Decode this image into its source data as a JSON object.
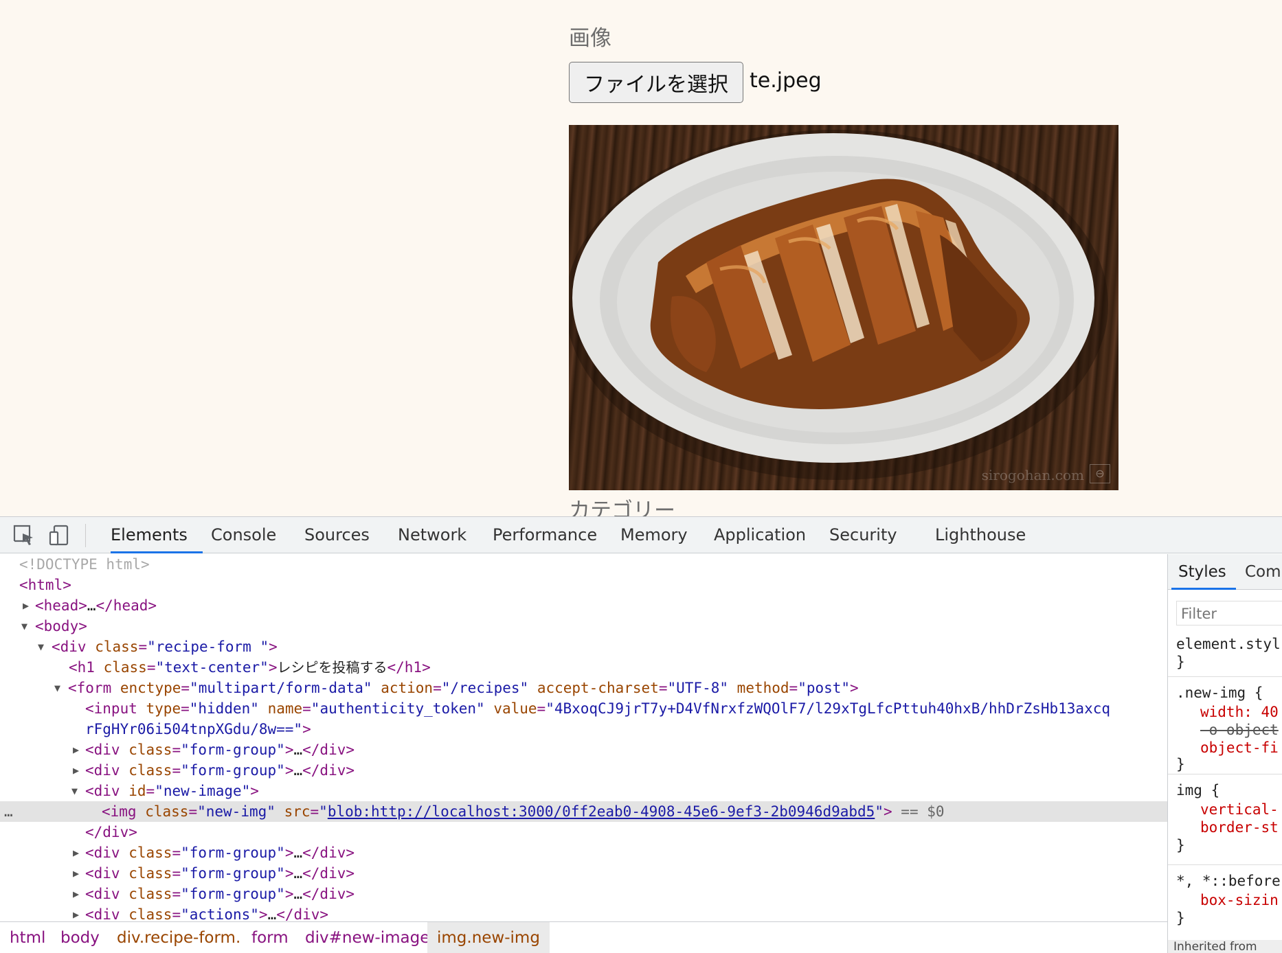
{
  "page": {
    "image_label": "画像",
    "file_button_label": "ファイルを選択",
    "file_name": "te.jpeg",
    "watermark": "sirogohan.com",
    "category_label": "カテゴリー"
  },
  "devtools": {
    "tabs": [
      "Elements",
      "Console",
      "Sources",
      "Network",
      "Performance",
      "Memory",
      "Application",
      "Security",
      "Lighthouse"
    ],
    "active_tab": "Elements",
    "dom": {
      "doctype": "<!DOCTYPE html>",
      "html_open": "<html>",
      "head": {
        "open": "<head>",
        "ellipsis": "…",
        "close": "</head>"
      },
      "body_open": "<body>",
      "div_recipe": {
        "tag": "<div",
        "attr": "class",
        "value": "\"recipe-form \"",
        "end": ">"
      },
      "h1": {
        "tag": "<h1",
        "attr": "class",
        "value": "\"text-center\"",
        "text": "レシピを投稿する",
        "close": "</h1>"
      },
      "form": {
        "tag": "<form",
        "attrs": [
          {
            "name": "enctype",
            "value": "\"multipart/form-data\""
          },
          {
            "name": "action",
            "value": "\"/recipes\""
          },
          {
            "name": "accept-charset",
            "value": "\"UTF-8\""
          },
          {
            "name": "method",
            "value": "\"post\""
          }
        ]
      },
      "input": {
        "tag": "<input",
        "type_attr": "type",
        "type_value": "\"hidden\"",
        "name_attr": "name",
        "name_value": "\"authenticity_token\"",
        "value_attr": "value",
        "value_line1": "\"4BxoqCJ9jrT7y+D4VfNrxfzWQOlF7/l29xTgLfcPttuh40hxB/hhDrZsHb13axcq",
        "value_line2": "rFgHYr06i504tnpXGdu/8w==\""
      },
      "form_group": {
        "tag": "<div",
        "attr": "class",
        "value": "\"form-group\"",
        "ellipsis": "…",
        "close": "</div>"
      },
      "new_image_div": {
        "tag": "<div",
        "attr": "id",
        "value": "\"new-image\""
      },
      "img": {
        "tag": "<img",
        "class_attr": "class",
        "class_value": "\"new-img\"",
        "src_attr": "src",
        "src": "blob:http://localhost:3000/0ff2eab0-4908-45e6-9ef3-2b0946d9abd5",
        "selected_marker": "== $0",
        "dots": "…"
      },
      "div_close": "</div>",
      "actions": {
        "tag": "<div",
        "attr": "class",
        "value": "\"actions\"",
        "ellipsis": "…",
        "close": "</div>"
      }
    },
    "breadcrumbs": [
      "html",
      "body",
      "div.recipe-form.",
      "form",
      "div#new-image",
      "img.new-img"
    ],
    "styles_panel": {
      "tabs": [
        "Styles",
        "Com"
      ],
      "active_tab": "Styles",
      "filter_placeholder": "Filter",
      "rules": [
        {
          "selector": "element.styl",
          "lines": []
        },
        {
          "selector": ".new-img {",
          "lines": [
            "width: 40",
            "-o-object",
            "object-fi"
          ]
        },
        {
          "selector": "img {",
          "lines": [
            "vertical-",
            "border-st"
          ]
        },
        {
          "selector": "*, *::before",
          "lines": [
            "box-sizin"
          ]
        }
      ],
      "close_brace": "}",
      "inherited_label": "Inherited from"
    }
  }
}
